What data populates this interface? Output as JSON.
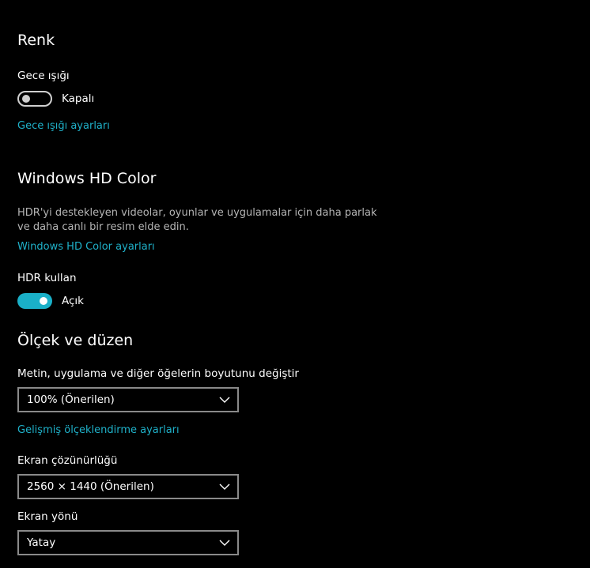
{
  "renk": {
    "title": "Renk",
    "night_light_label": "Gece ışığı",
    "night_light_state": "Kapalı",
    "night_light_on": false,
    "night_light_settings_link": "Gece ışığı ayarları"
  },
  "hd_color": {
    "title": "Windows HD Color",
    "description": "HDR'yi destekleyen videolar, oyunlar ve uygulamalar için daha parlak ve daha canlı bir resim elde edin.",
    "settings_link": "Windows HD Color ayarları",
    "hdr_label": "HDR kullan",
    "hdr_state": "Açık",
    "hdr_on": true
  },
  "scale_layout": {
    "title": "Ölçek ve düzen",
    "scale_label": "Metin, uygulama ve diğer öğelerin boyutunu değiştir",
    "scale_value": "100% (Önerilen)",
    "advanced_scaling_link": "Gelişmiş ölçeklendirme ayarları",
    "resolution_label": "Ekran çözünürlüğü",
    "resolution_value": "2560 × 1440 (Önerilen)",
    "orientation_label": "Ekran yönü",
    "orientation_value": "Yatay"
  },
  "colors": {
    "accent": "#1ab0c8",
    "link": "#1fb1c9",
    "background": "#000000",
    "description_text": "#b5b5b5",
    "dropdown_border": "#8a8a8a"
  },
  "icons": {
    "dropdown_chevron": "chevron-down-icon"
  }
}
